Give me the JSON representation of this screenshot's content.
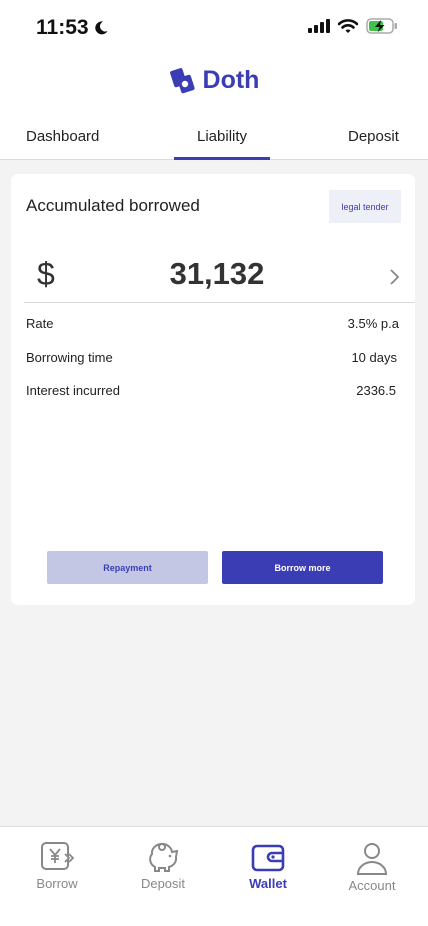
{
  "status": {
    "time": "11:53"
  },
  "brand": {
    "name": "Doth",
    "accent": "#3b3db5"
  },
  "tabs": [
    {
      "label": "Dashboard"
    },
    {
      "label": "Liability",
      "active": true
    },
    {
      "label": "Deposit"
    }
  ],
  "card": {
    "title": "Accumulated borrowed",
    "legal_tender_label": "legal tender",
    "currency_symbol": "$",
    "amount": "31,132",
    "rows": [
      {
        "label": "Rate",
        "value": "3.5% p.a"
      },
      {
        "label": "Borrowing time",
        "value": "10 days"
      },
      {
        "label": "Interest incurred",
        "value": "2336.5"
      }
    ],
    "repayment_label": "Repayment",
    "borrow_more_label": "Borrow more"
  },
  "bottom_nav": [
    {
      "label": "Borrow",
      "icon": "borrow-icon"
    },
    {
      "label": "Deposit",
      "icon": "piggy-bank-icon"
    },
    {
      "label": "Wallet",
      "icon": "wallet-icon",
      "active": true
    },
    {
      "label": "Account",
      "icon": "person-icon"
    }
  ]
}
